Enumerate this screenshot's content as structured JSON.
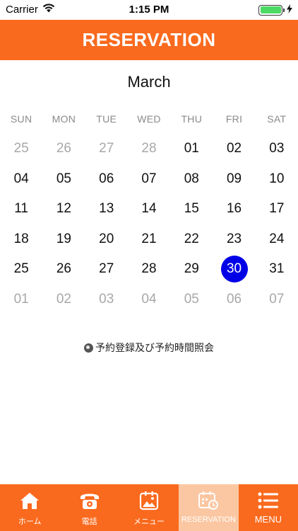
{
  "status_bar": {
    "carrier": "Carrier",
    "time": "1:15 PM",
    "wifi_icon": "wifi-icon",
    "battery_icon": "battery-icon",
    "charging_icon": "charging-bolt-icon"
  },
  "header": {
    "title": "RESERVATION"
  },
  "calendar": {
    "month": "March",
    "weekdays": [
      "SUN",
      "MON",
      "TUE",
      "WED",
      "THU",
      "FRI",
      "SAT"
    ],
    "selected_day": "30",
    "selected_color": "#0000e6",
    "weeks": [
      [
        {
          "d": "25",
          "muted": true
        },
        {
          "d": "26",
          "muted": true
        },
        {
          "d": "27",
          "muted": true
        },
        {
          "d": "28",
          "muted": true
        },
        {
          "d": "01",
          "muted": false
        },
        {
          "d": "02",
          "muted": false
        },
        {
          "d": "03",
          "muted": false
        }
      ],
      [
        {
          "d": "04",
          "muted": false
        },
        {
          "d": "05",
          "muted": false
        },
        {
          "d": "06",
          "muted": false
        },
        {
          "d": "07",
          "muted": false
        },
        {
          "d": "08",
          "muted": false
        },
        {
          "d": "09",
          "muted": false
        },
        {
          "d": "10",
          "muted": false
        }
      ],
      [
        {
          "d": "11",
          "muted": false
        },
        {
          "d": "12",
          "muted": false
        },
        {
          "d": "13",
          "muted": false
        },
        {
          "d": "14",
          "muted": false
        },
        {
          "d": "15",
          "muted": false
        },
        {
          "d": "16",
          "muted": false
        },
        {
          "d": "17",
          "muted": false
        }
      ],
      [
        {
          "d": "18",
          "muted": false
        },
        {
          "d": "19",
          "muted": false
        },
        {
          "d": "20",
          "muted": false
        },
        {
          "d": "21",
          "muted": false
        },
        {
          "d": "22",
          "muted": false
        },
        {
          "d": "23",
          "muted": false
        },
        {
          "d": "24",
          "muted": false
        }
      ],
      [
        {
          "d": "25",
          "muted": false
        },
        {
          "d": "26",
          "muted": false
        },
        {
          "d": "27",
          "muted": false
        },
        {
          "d": "28",
          "muted": false
        },
        {
          "d": "29",
          "muted": false
        },
        {
          "d": "30",
          "muted": false,
          "selected": true
        },
        {
          "d": "31",
          "muted": false
        }
      ],
      [
        {
          "d": "01",
          "muted": true
        },
        {
          "d": "02",
          "muted": true
        },
        {
          "d": "03",
          "muted": true
        },
        {
          "d": "04",
          "muted": true
        },
        {
          "d": "05",
          "muted": true
        },
        {
          "d": "06",
          "muted": true
        },
        {
          "d": "07",
          "muted": true
        }
      ]
    ]
  },
  "reservation_link": {
    "label": "予約登録及び予約時間照会",
    "icon": "globe-icon"
  },
  "tabbar": {
    "accent_color": "#fa6a1e",
    "items": [
      {
        "label": "ホーム",
        "icon": "home-icon",
        "active": false
      },
      {
        "label": "電話",
        "icon": "phone-icon",
        "active": false
      },
      {
        "label": "メニュー",
        "icon": "menu-photo-icon",
        "active": false
      },
      {
        "label": "RESERVATION",
        "icon": "calendar-clock-icon",
        "active": true
      },
      {
        "label": "MENU",
        "icon": "list-menu-icon",
        "active": false
      }
    ]
  }
}
